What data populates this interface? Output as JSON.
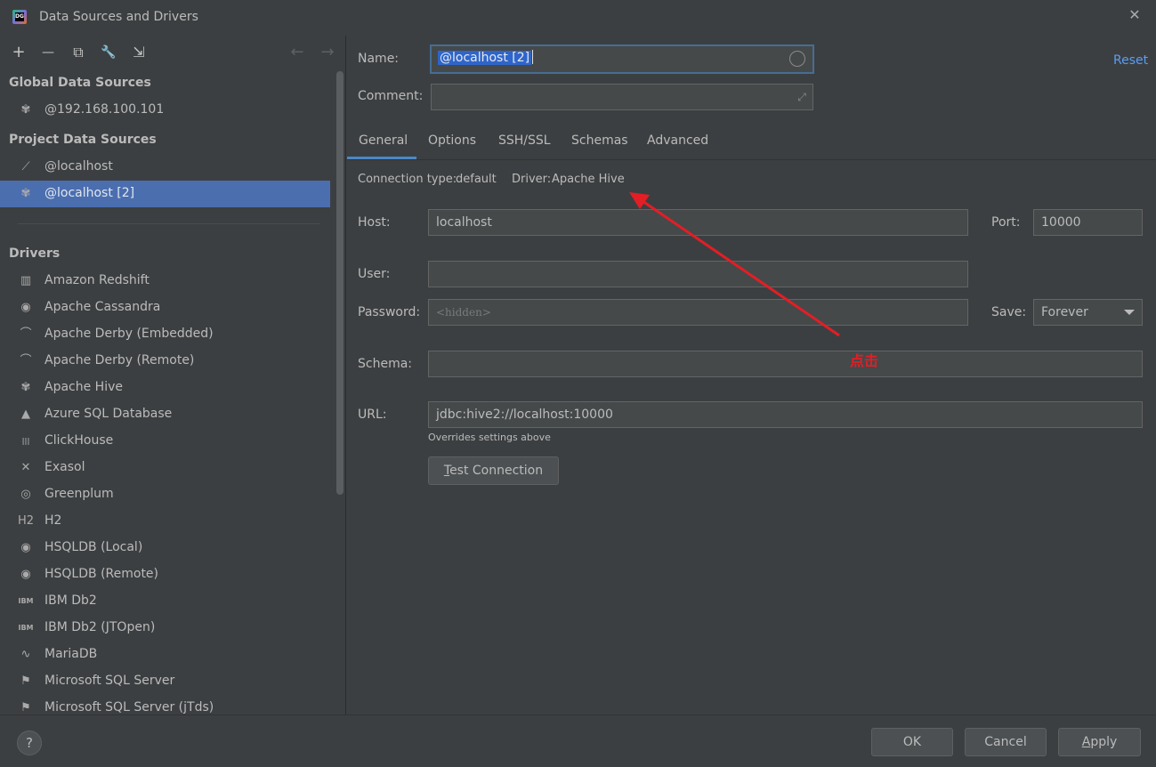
{
  "window": {
    "title": "Data Sources and Drivers",
    "logo_text": "DG"
  },
  "toolbar": {
    "add": "+",
    "remove": "—",
    "copy": "⧉",
    "settings": "🔧",
    "import": "⇲",
    "back": "←",
    "forward": "→"
  },
  "global_sources": {
    "title": "Global Data Sources",
    "items": [
      {
        "label": "@192.168.100.101",
        "icon": "hive-icon"
      }
    ]
  },
  "project_sources": {
    "title": "Project Data Sources",
    "items": [
      {
        "label": "@localhost",
        "icon": "generic-db-icon"
      },
      {
        "label": "@localhost [2]",
        "icon": "hive-icon",
        "selected": true
      }
    ]
  },
  "drivers": {
    "title": "Drivers",
    "items": [
      {
        "label": "Amazon Redshift",
        "glyph": "▥"
      },
      {
        "label": "Apache Cassandra",
        "glyph": "◉"
      },
      {
        "label": "Apache Derby (Embedded)",
        "glyph": "⌒"
      },
      {
        "label": "Apache Derby (Remote)",
        "glyph": "⌒"
      },
      {
        "label": "Apache Hive",
        "glyph": "✾"
      },
      {
        "label": "Azure SQL Database",
        "glyph": "▲"
      },
      {
        "label": "ClickHouse",
        "glyph": "|||"
      },
      {
        "label": "Exasol",
        "glyph": "✕"
      },
      {
        "label": "Greenplum",
        "glyph": "◎"
      },
      {
        "label": "H2",
        "glyph": "H2"
      },
      {
        "label": "HSQLDB (Local)",
        "glyph": "◉"
      },
      {
        "label": "HSQLDB (Remote)",
        "glyph": "◉"
      },
      {
        "label": "IBM Db2",
        "glyph": "IBM"
      },
      {
        "label": "IBM Db2 (JTOpen)",
        "glyph": "IBM"
      },
      {
        "label": "MariaDB",
        "glyph": "∿"
      },
      {
        "label": "Microsoft SQL Server",
        "glyph": "⚑"
      },
      {
        "label": "Microsoft SQL Server (jTds)",
        "glyph": "⚑"
      }
    ]
  },
  "form": {
    "name_label": "Name:",
    "name_value": "@localhost [2]",
    "comment_label": "Comment:",
    "comment_value": "",
    "reset": "Reset",
    "tabs": [
      "General",
      "Options",
      "SSH/SSL",
      "Schemas",
      "Advanced"
    ],
    "active_tab": "General",
    "connection_type_label": "Connection type:",
    "connection_type_value": "default",
    "driver_label": "Driver:",
    "driver_value": "Apache Hive",
    "host_label": "Host:",
    "host_value": "localhost",
    "port_label": "Port:",
    "port_value": "10000",
    "user_label": "User:",
    "user_value": "",
    "password_label": "Password:",
    "password_placeholder": "<hidden>",
    "save_label": "Save:",
    "save_value": "Forever",
    "schema_label": "Schema:",
    "schema_value": "",
    "url_label": "URL:",
    "url_value": "jdbc:hive2://localhost:10000",
    "url_hint": "Overrides settings above",
    "test_connection": "Test Connection"
  },
  "annotation": {
    "text": "点击",
    "color": "#e31e25"
  },
  "footer": {
    "help": "?",
    "ok": "OK",
    "cancel": "Cancel",
    "apply": "Apply"
  },
  "colors": {
    "background": "#3c3f41",
    "selection": "#4b6eaf",
    "link": "#589df6",
    "tab_underline": "#4a88c7"
  }
}
